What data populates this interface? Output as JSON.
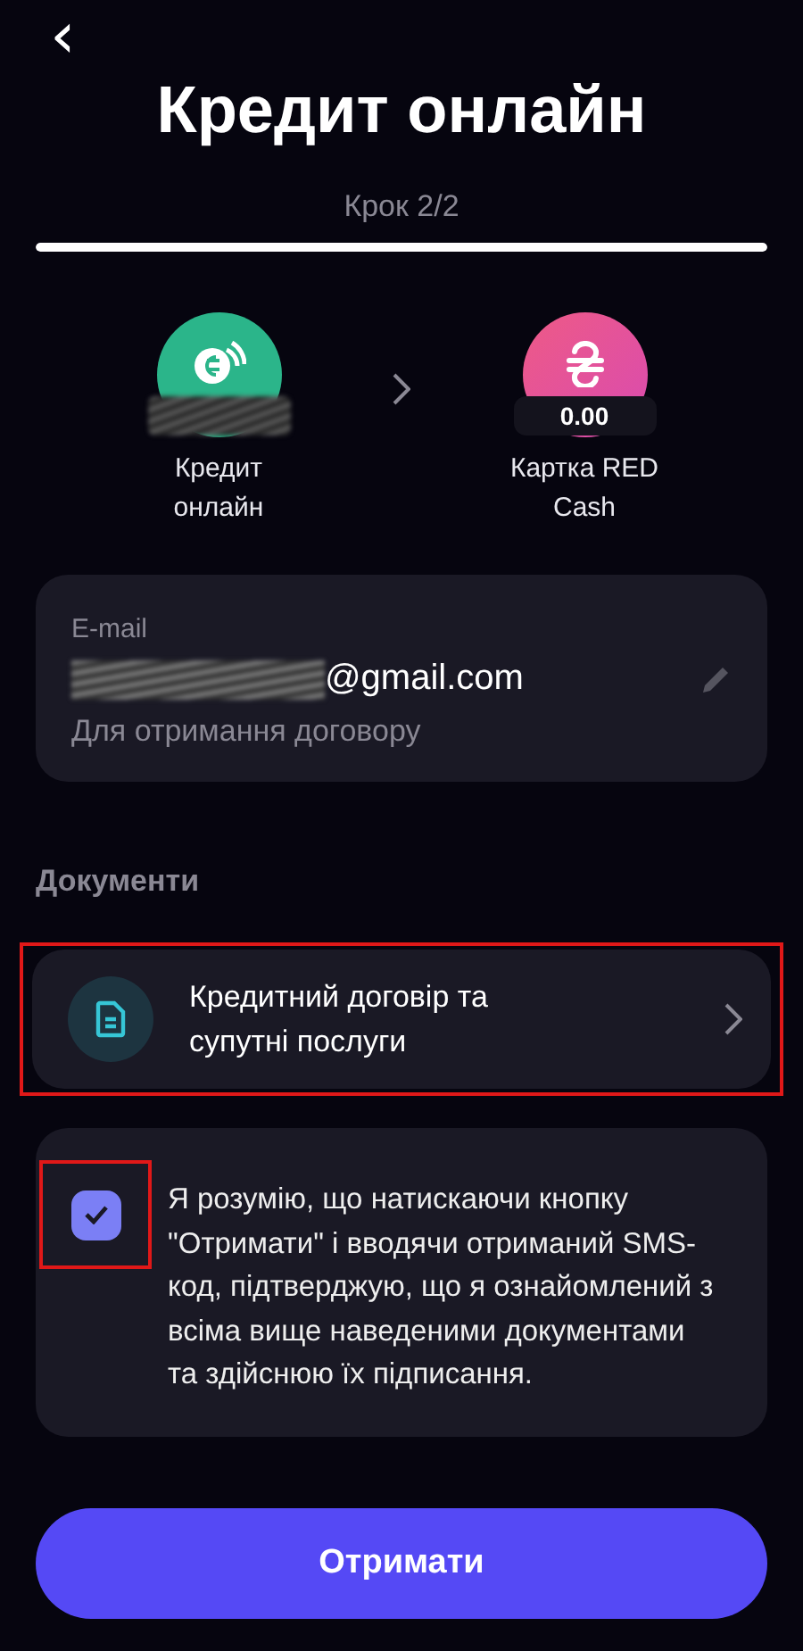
{
  "header": {
    "back": "‹",
    "title": "Кредит онлайн"
  },
  "progress": {
    "step": "Крок 2/2",
    "level": 1
  },
  "transfer": {
    "accounts": [
      {
        "kind": "loan",
        "label": "Кредит онлайн",
        "color": "#2bb58a",
        "balance_hidden": true
      },
      {
        "kind": "card",
        "label": "Картка RED Cash",
        "color": "#ee5a86",
        "balance": "0.00",
        "balance_hidden": false
      }
    ]
  },
  "email": {
    "label": "E-mail",
    "value": "@gmail.com",
    "value_partly_hidden": true,
    "hint": "Для отримання договору"
  },
  "documents": {
    "title": "Документи",
    "items": [
      {
        "label": "Кредитний договір та супутні послуги",
        "highlighted": true
      }
    ]
  },
  "consent": {
    "checked": true,
    "highlighted": true,
    "text": "Я розумію, що натискаючи кнопку \"Отримати\" і вводячи отриманий SMS-код, підтверджую, що я ознайомлений з всіма вище наведеними документами та здійснюю їх підписання."
  },
  "submit": {
    "label": "Отримати"
  }
}
